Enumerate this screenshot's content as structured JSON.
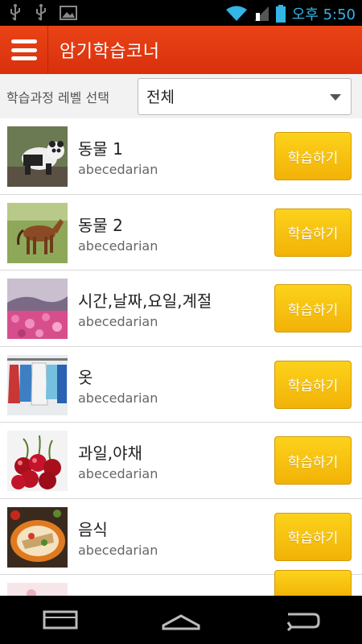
{
  "status_bar": {
    "time": "오후 5:50",
    "icons": [
      "usb-icon",
      "usb-icon",
      "image-icon",
      "wifi-icon",
      "signal-icon",
      "battery-icon"
    ]
  },
  "app_bar": {
    "title": "암기학습코너",
    "menu_icon": "hamburger-menu-icon"
  },
  "filter": {
    "label": "학습과정 레벨 선택",
    "selected": "전체"
  },
  "items": [
    {
      "title": "동물 1",
      "subtitle": "abecedarian",
      "button": "학습하기",
      "image": "panda"
    },
    {
      "title": "동물 2",
      "subtitle": "abecedarian",
      "button": "학습하기",
      "image": "horse"
    },
    {
      "title": "시간,날짜,요일,계절",
      "subtitle": "abecedarian",
      "button": "학습하기",
      "image": "flowers"
    },
    {
      "title": "옷",
      "subtitle": "abecedarian",
      "button": "학습하기",
      "image": "clothes"
    },
    {
      "title": "과일,야채",
      "subtitle": "abecedarian",
      "button": "학습하기",
      "image": "cherries"
    },
    {
      "title": "음식",
      "subtitle": "abecedarian",
      "button": "학습하기",
      "image": "food"
    }
  ],
  "nav_bar": {
    "icons": [
      "back-icon",
      "home-icon",
      "recent-apps-icon"
    ]
  },
  "colors": {
    "app_bar": "#e23a12",
    "button": "#f5bd0c",
    "status_icon": "#33b5e5"
  }
}
